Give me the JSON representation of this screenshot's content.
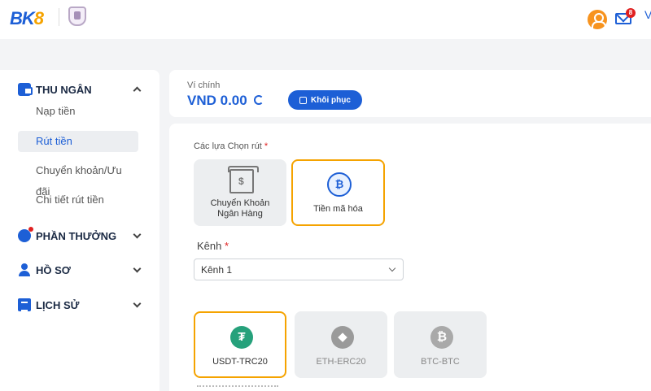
{
  "header": {
    "logo_prefix": "BK",
    "logo_suffix": "8",
    "mail_badge": "8",
    "user_initial": "V"
  },
  "sidebar": {
    "sections": [
      {
        "label": "THU NGÂN",
        "icon": "wallet-icon",
        "expanded": true
      },
      {
        "label": "PHẦN THƯỞNG",
        "icon": "reward-icon"
      },
      {
        "label": "HỒ SƠ",
        "icon": "profile-icon"
      },
      {
        "label": "LỊCH SỬ",
        "icon": "history-icon"
      }
    ],
    "subitems": [
      "Nạp tiền",
      "Rút tiền",
      "Chuyển khoản/Ưu đãi",
      "Chi tiết rút tiền"
    ],
    "active_subitem": "Rút tiền"
  },
  "wallet": {
    "label": "Ví chính",
    "balance": "VND 0.00",
    "restore_label": "Khôi phục"
  },
  "withdraw": {
    "options_label": "Các lựa Chọn rút",
    "required_mark": "*",
    "methods": [
      {
        "label": "Chuyển Khoản Ngân Hàng",
        "icon": "bank-icon",
        "selected": false
      },
      {
        "label": "Tiền mã hóa",
        "icon": "crypto-icon",
        "selected": true
      }
    ],
    "channel_label": "Kênh",
    "channel_value": "Kênh 1",
    "networks": [
      {
        "label": "USDT-TRC20",
        "icon": "tether-icon",
        "glyph": "₮",
        "selected": true
      },
      {
        "label": "ETH-ERC20",
        "icon": "eth-icon",
        "glyph": "◆",
        "selected": false
      },
      {
        "label": "BTC-BTC",
        "icon": "btc-icon",
        "glyph": "₿",
        "selected": false
      }
    ]
  },
  "colors": {
    "brand_blue": "#1d5fd6",
    "accent_orange": "#f5a300",
    "badge_red": "#e02020",
    "tether_green": "#26a17b"
  }
}
